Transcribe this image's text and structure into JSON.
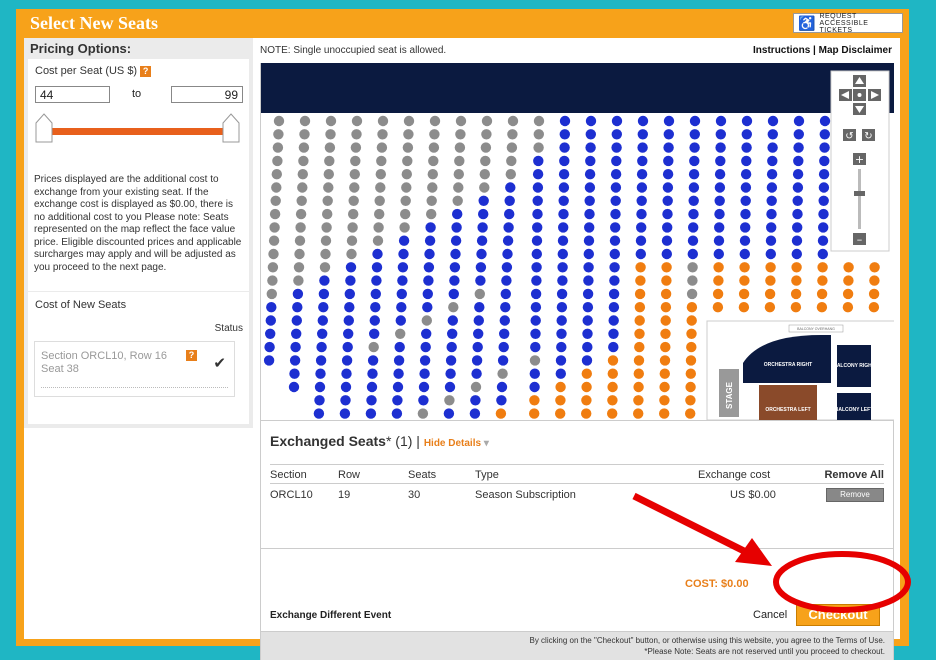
{
  "header": {
    "title": "Select New Seats",
    "request_btn_line1": "REQUEST",
    "request_btn_line2": "ACCESSIBLE TICKETS"
  },
  "pricing": {
    "heading": "Pricing Options:",
    "cost_label": "Cost per Seat (US $)",
    "min_value": "44",
    "to_label": "to",
    "max_value": "99",
    "description": "Prices displayed are the additional cost to exchange from your existing seat. If the exchange cost is displayed as $0.00, there is no additional cost to you Please note: Seats represented on the map reflect the face value price. Eligible discounted prices and applicable surcharges may apply and will be adjusted as you proceed to the next page."
  },
  "new_seats": {
    "heading": "Cost of New Seats",
    "status_label": "Status",
    "seat_line1": "Section ORCL10, Row 16",
    "seat_line2": "Seat 38"
  },
  "map": {
    "note": "NOTE: Single unoccupied seat is allowed.",
    "instructions": "Instructions",
    "separator": " | ",
    "disclaimer": "Map Disclaimer",
    "mini_labels": {
      "stage": "STAGE",
      "orchestra_right": "ORCHESTRA RIGHT",
      "orchestra_left": "ORCHESTRA LEFT",
      "balcony_right": "BALCONY RIGHT",
      "balcony_left": "BALCONY LEFT",
      "balcony_overhang": "BALCONY OVERHANG"
    },
    "colors": {
      "available": "#1d2fd1",
      "unavailable": "#8c8c8c",
      "priced": "#f07d10",
      "selected": "#2dc93a",
      "header_bar": "#0b1a40"
    }
  },
  "exchanged": {
    "title": "Exchanged Seats",
    "count": "* (1) |",
    "hide_details": "Hide Details",
    "columns": [
      "Section",
      "Row",
      "Seats",
      "Type",
      "Exchange cost",
      "Remove All"
    ],
    "rows": [
      {
        "section": "ORCL10",
        "row": "19",
        "seats": "30",
        "type": "Season Subscription",
        "cost": "US $0.00",
        "remove": "Remove"
      }
    ],
    "total_label": "COST: $0.00",
    "exchange_different": "Exchange Different Event",
    "cancel": "Cancel",
    "checkout": "Checkout",
    "legal1": "By clicking on the \"Checkout\" button, or otherwise using this website, you agree to the Terms of Use.",
    "legal2": "*Please Note: Seats are not reserved until you proceed to checkout."
  }
}
